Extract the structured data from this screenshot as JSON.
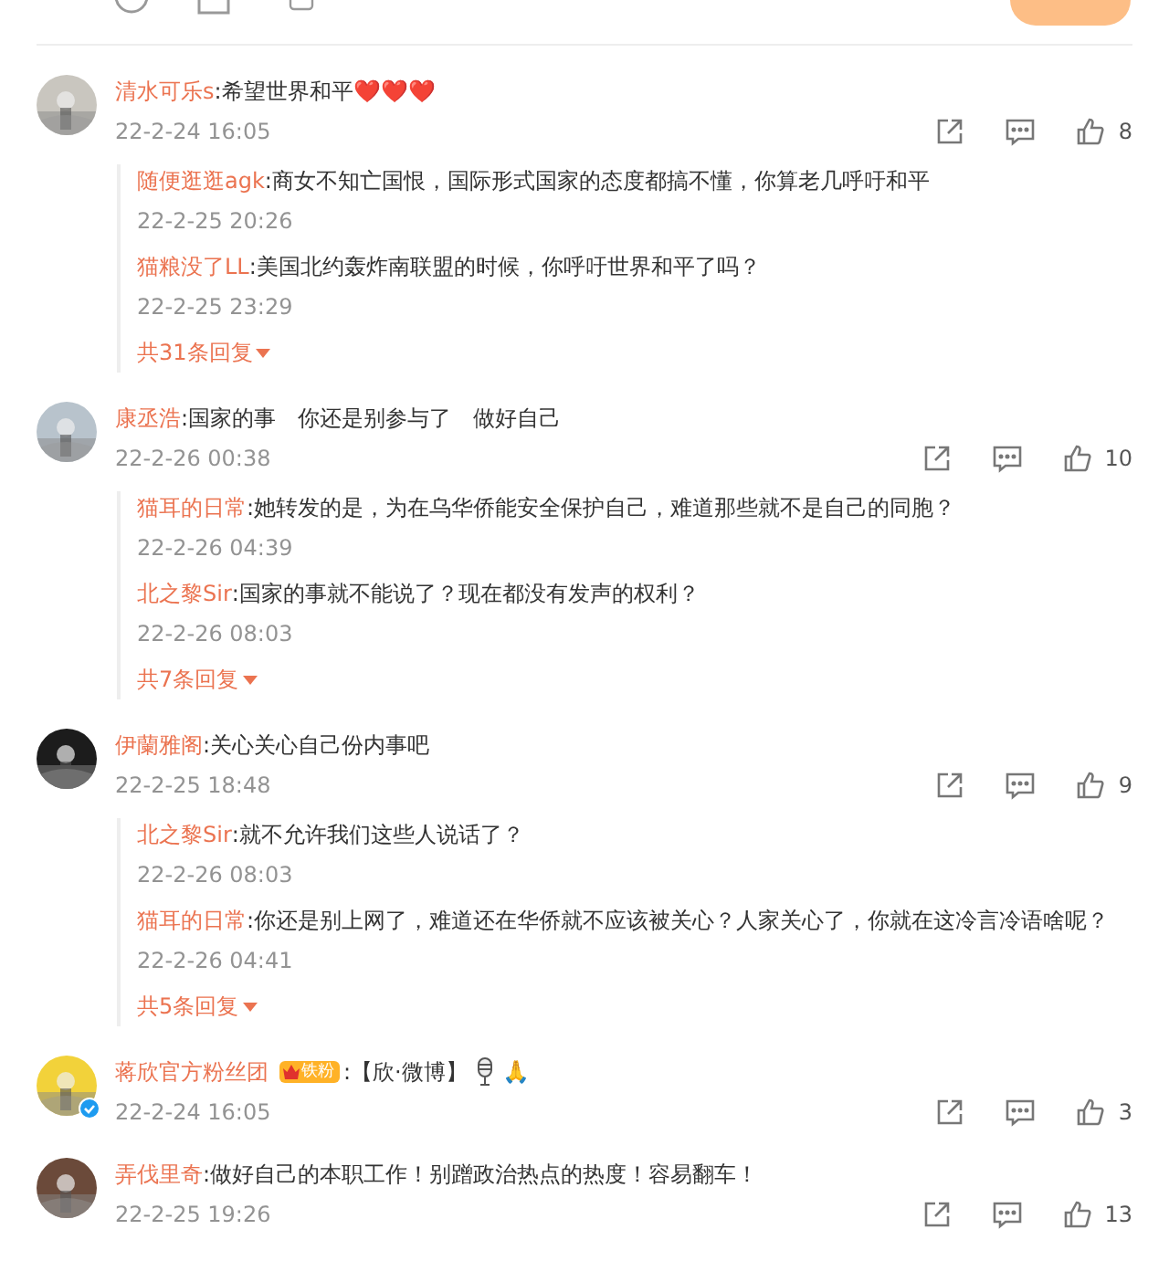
{
  "comments": [
    {
      "user": "清水可乐s",
      "text": ":希望世界和平❤️❤️❤️",
      "time": "22-2-24 16:05",
      "likes": "8",
      "replies": [
        {
          "user": "随便逛逛agk",
          "text": ":商女不知亡国恨，国际形式国家的态度都搞不懂，你算老几呼吁和平",
          "time": "22-2-25 20:26"
        },
        {
          "user": "猫粮没了LL",
          "text": ":美国北约轰炸南联盟的时候，你呼吁世界和平了吗？",
          "time": "22-2-25 23:29"
        }
      ],
      "more": "共31条回复"
    },
    {
      "user": "康丞浩",
      "text": ":国家的事　你还是别参与了　做好自己",
      "time": "22-2-26 00:38",
      "likes": "10",
      "replies": [
        {
          "user": "猫耳的日常",
          "text": ":她转发的是，为在乌华侨能安全保护自己，难道那些就不是自己的同胞？",
          "time": "22-2-26 04:39"
        },
        {
          "user": "北之黎Sir",
          "text": ":国家的事就不能说了？现在都没有发声的权利？",
          "time": "22-2-26 08:03"
        }
      ],
      "more": "共7条回复"
    },
    {
      "user": "伊蘭雅阁",
      "text": ":关心关心自己份内事吧",
      "time": "22-2-25 18:48",
      "likes": "9",
      "replies": [
        {
          "user": "北之黎Sir",
          "text": ":就不允许我们这些人说话了？",
          "time": "22-2-26 08:03"
        },
        {
          "user": "猫耳的日常",
          "text": ":你还是别上网了，难道还在华侨就不应该被关心？人家关心了，你就在这冷言冷语啥呢？",
          "time": "22-2-26 04:41"
        }
      ],
      "more": "共5条回复"
    },
    {
      "user": "蒋欣官方粉丝团",
      "badge": "铁粉",
      "text": ":【欣·微博】",
      "text_end": "🙏",
      "time": "22-2-24 16:05",
      "likes": "3",
      "verified": true
    },
    {
      "user": "弄伐里奇",
      "text": ":做好自己的本职工作！别蹭政治热点的热度！容易翻车！",
      "time": "22-2-25 19:26",
      "likes": "13"
    }
  ]
}
